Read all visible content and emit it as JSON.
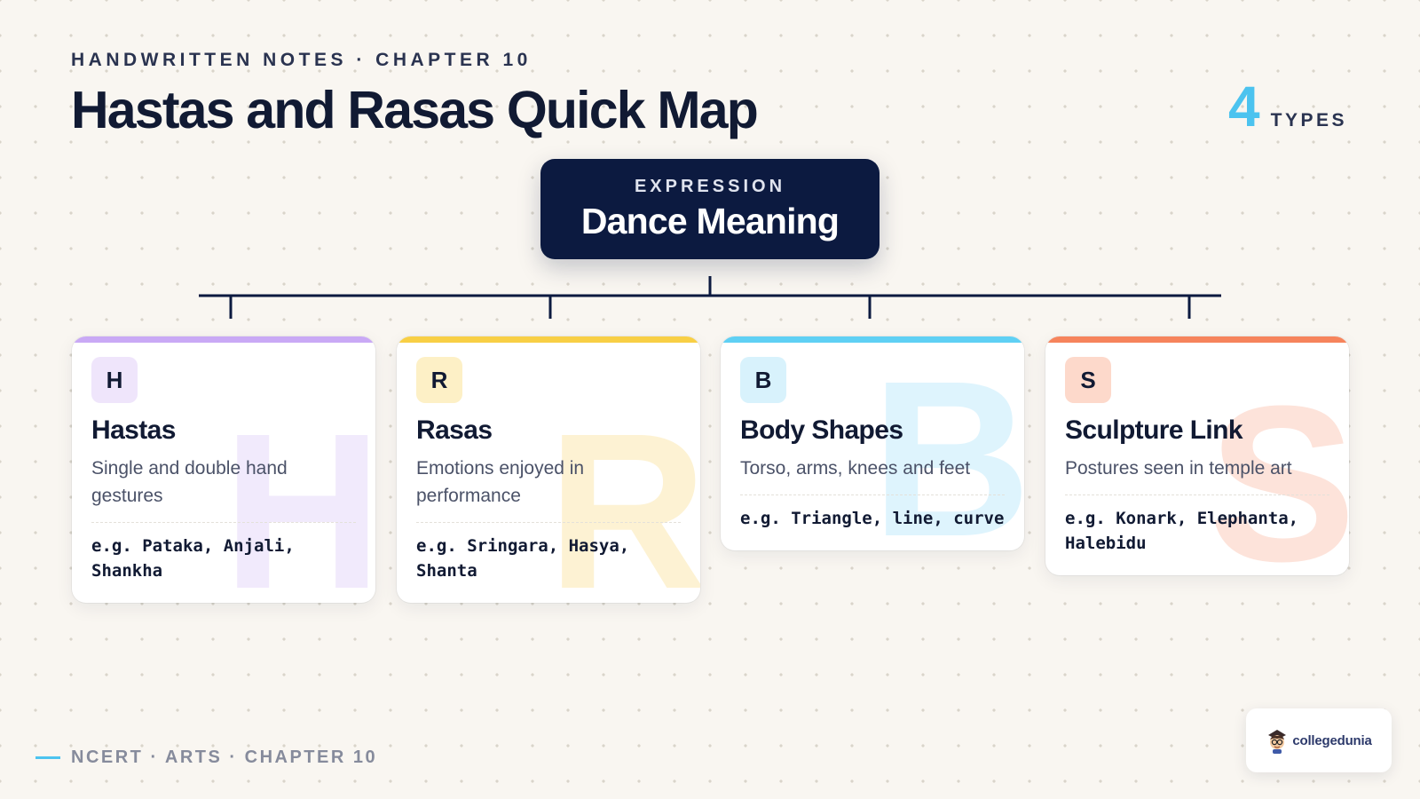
{
  "header": {
    "kicker": "HANDWRITTEN NOTES · CHAPTER 10",
    "title": "Hastas and Rasas Quick Map",
    "count_value": "4",
    "count_label": "TYPES"
  },
  "root": {
    "kicker": "EXPRESSION",
    "title": "Dance Meaning"
  },
  "cards": [
    {
      "badge": "H",
      "title": "Hastas",
      "description": "Single and double hand gestures",
      "example": "e.g. Pataka, Anjali, Shankha",
      "accent": "#c9a9f5",
      "badge_bg": "#efe5fb",
      "watermark_color": "#f1eafc"
    },
    {
      "badge": "R",
      "title": "Rasas",
      "description": "Emotions enjoyed in performance",
      "example": "e.g. Sringara, Hasya, Shanta",
      "accent": "#f8cf45",
      "badge_bg": "#fdf0c6",
      "watermark_color": "#fdf2d3"
    },
    {
      "badge": "B",
      "title": "Body Shapes",
      "description": "Torso, arms, knees and feet",
      "example": "e.g. Triangle, line, curve",
      "accent": "#5fd0f4",
      "badge_bg": "#d8f2fc",
      "watermark_color": "#def4fd"
    },
    {
      "badge": "S",
      "title": "Sculpture Link",
      "description": "Postures seen in temple art",
      "example": "e.g. Konark, Elephanta, Halebidu",
      "accent": "#f6845c",
      "badge_bg": "#fdd9cb",
      "watermark_color": "#fde3da"
    }
  ],
  "footer": {
    "text": "NCERT · ARTS · CHAPTER 10",
    "logo_text": "collegedunia",
    "logo_icon": "student-mascot-icon"
  },
  "colors": {
    "background": "#f9f6f1",
    "navy": "#0c1a40",
    "accent_blue": "#4cc3ef"
  }
}
